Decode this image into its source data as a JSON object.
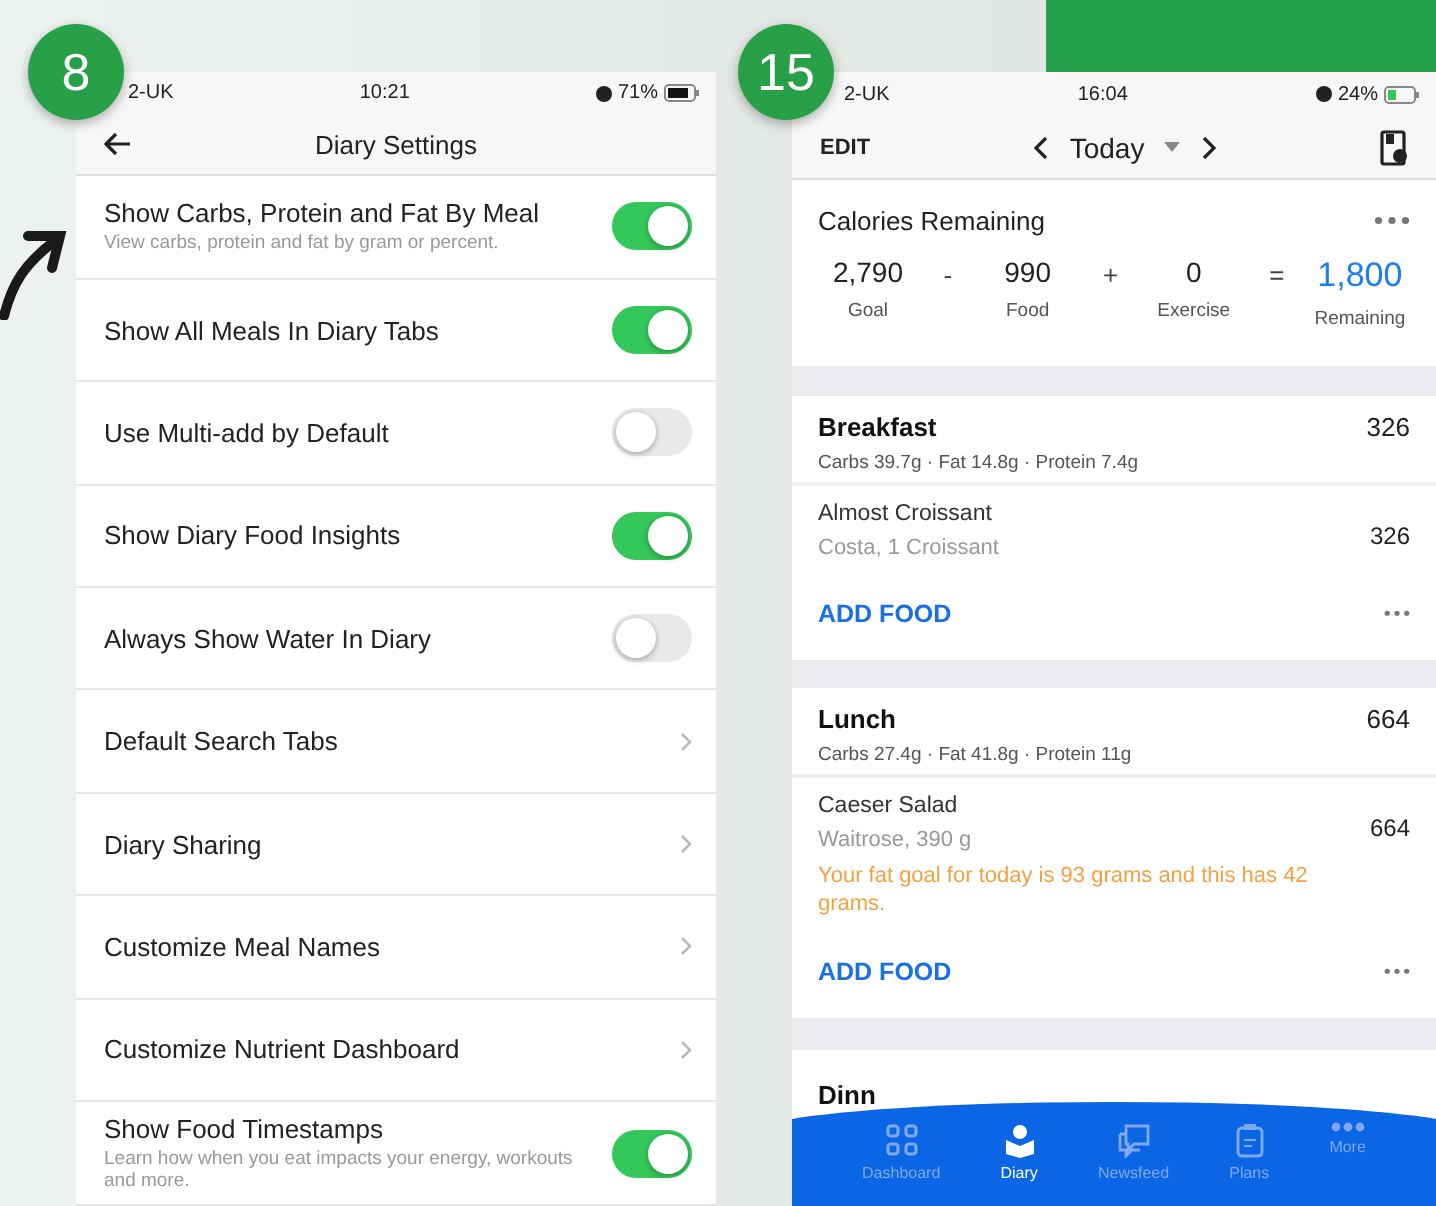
{
  "steps": [
    {
      "number": "8",
      "status": {
        "carrier": "2-UK",
        "time": "10:21",
        "battery": "71%"
      },
      "title": "Diary Settings",
      "settings": [
        {
          "kind": "toggle",
          "label": "Show Carbs, Protein and Fat By Meal",
          "hint": "View carbs, protein and fat by gram or percent.",
          "on": true
        },
        {
          "kind": "toggle",
          "label": "Show All Meals In Diary Tabs",
          "on": true
        },
        {
          "kind": "toggle",
          "label": "Use Multi-add by Default",
          "on": false
        },
        {
          "kind": "toggle",
          "label": "Show Diary Food Insights",
          "on": true
        },
        {
          "kind": "toggle",
          "label": "Always Show Water In Diary",
          "on": false
        },
        {
          "kind": "link",
          "label": "Default Search Tabs"
        },
        {
          "kind": "link",
          "label": "Diary Sharing"
        },
        {
          "kind": "link",
          "label": "Customize Meal Names"
        },
        {
          "kind": "link",
          "label": "Customize Nutrient Dashboard"
        },
        {
          "kind": "toggle",
          "label": "Show Food Timestamps",
          "hint": "Learn how when you eat impacts your energy, workouts and more.",
          "on": true
        }
      ]
    },
    {
      "number": "15",
      "status": {
        "carrier": "2-UK",
        "time": "16:04",
        "battery": "24%"
      },
      "edit": "EDIT",
      "day": "Today",
      "calories": {
        "title": "Calories Remaining",
        "terms": [
          {
            "value": "2,790",
            "label": "Goal"
          },
          {
            "value": "990",
            "label": "Food",
            "op": "-"
          },
          {
            "value": "0",
            "label": "Exercise",
            "op": "+"
          },
          {
            "value": "1,800",
            "label": "Remaining",
            "op": "="
          }
        ]
      },
      "meals": [
        {
          "name": "Breakfast",
          "total": "326",
          "macros": "Carbs 39.7g · Fat 14.8g · Protein 7.4g",
          "foods": [
            {
              "name": "Almost Croissant",
              "detail": "Costa, 1 Croissant",
              "calories": "326"
            }
          ],
          "add": "ADD FOOD"
        },
        {
          "name": "Lunch",
          "total": "664",
          "macros": "Carbs 27.4g · Fat 41.8g · Protein 11g",
          "foods": [
            {
              "name": "Caeser Salad",
              "detail": "Waitrose, 390 g",
              "calories": "664",
              "insight": "Your fat goal for today is 93 grams and this has 42 grams."
            }
          ],
          "add": "ADD FOOD"
        }
      ],
      "next_meal": "Dinn",
      "tabs": [
        {
          "label": "Dashboard",
          "selected": false
        },
        {
          "label": "Diary",
          "selected": true
        },
        {
          "label": "Newsfeed",
          "selected": false
        },
        {
          "label": "Plans",
          "selected": false
        },
        {
          "label": "More",
          "selected": false
        }
      ]
    }
  ]
}
